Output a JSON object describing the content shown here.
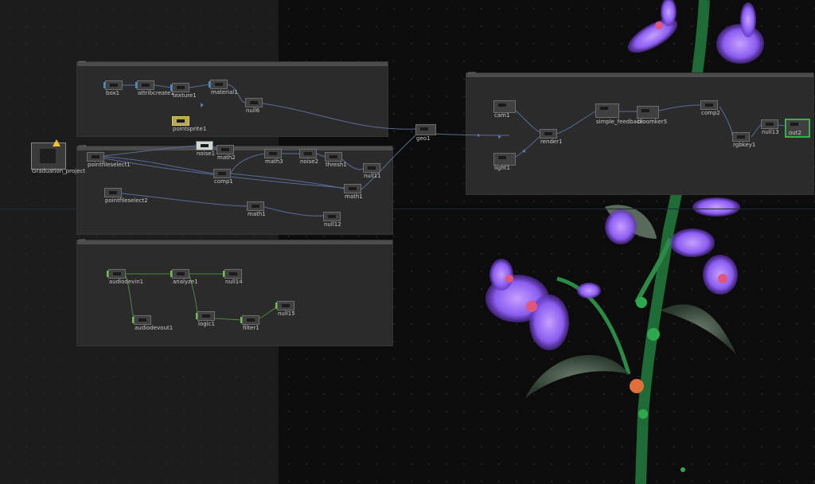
{
  "network": {
    "project_label": "Graduation_project",
    "comps": {
      "top": {
        "title": "scene"
      },
      "middle": {
        "title": "points"
      },
      "bottom": {
        "title": "audio"
      },
      "render": {
        "title": "render"
      }
    },
    "nodes": {
      "box1": "box1",
      "attribcreate": "attribcreate1",
      "texture1": "texture1",
      "material1": "material1",
      "null6": "null6",
      "pointsprite1": "pointsprite1",
      "pointfileselect1": "pointfileselect1",
      "noise1": "noise1",
      "math2": "math2",
      "math3": "math3",
      "noise2": "noise2",
      "thresh1": "thresh1",
      "null11": "null11",
      "comp1": "comp1",
      "math1_merge": "math1",
      "pointfileselect2": "pointfileselect2",
      "math1": "math1",
      "null12": "null12",
      "geo1": "geo1",
      "audiodevin1": "audiodevin1",
      "analyze1": "analyze1",
      "null14": "null14",
      "audiodevout1": "audiodevout1",
      "logic1": "logic1",
      "filter1": "filter1",
      "null15": "null15",
      "cam1": "cam1",
      "light1": "light1",
      "render1": "render1",
      "simplefeedback": "simple_feedback",
      "bloomker5": "bloomker5",
      "comp2": "comp2",
      "rgbkey1": "rgbkey1",
      "null13": "null13",
      "out2": "out2"
    },
    "colors": {
      "accent_selected": "#2fb34a",
      "warning": "#f0c230",
      "sop_tag": "#3e8fd8",
      "chop_tag": "#6fc24a",
      "top_tag": "#8b6ad8",
      "mat_tag": "#d8c85a"
    }
  }
}
